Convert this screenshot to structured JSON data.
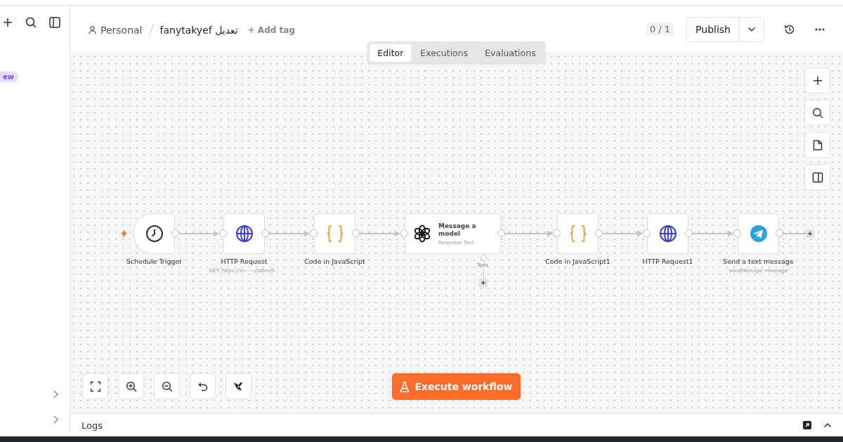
{
  "sidebar": {
    "badge": "ew"
  },
  "header": {
    "project": "Personal",
    "workflow": "fanytakyef تعديل",
    "add_tag": "+ Add tag",
    "counter": "0 / 1",
    "publish": "Publish"
  },
  "tabs": [
    {
      "label": "Editor",
      "selected": true
    },
    {
      "label": "Executions",
      "selected": false
    },
    {
      "label": "Evaluations",
      "selected": false
    }
  ],
  "nodes": [
    {
      "kind": "trigger",
      "label": "Schedule Trigger"
    },
    {
      "kind": "http",
      "label": "HTTP Request",
      "subtitle": "GET: https://xn-----ctdbnc9..."
    },
    {
      "kind": "code",
      "label": "Code in JavaScript"
    },
    {
      "kind": "ai",
      "label": "Message a model",
      "subtitle": "Response Text",
      "sub_port": "Tools"
    },
    {
      "kind": "code",
      "label": "Code in JavaScript1"
    },
    {
      "kind": "http",
      "label": "HTTP Request1"
    },
    {
      "kind": "telegram",
      "label": "Send a text message",
      "subtitle": "sendMessage: message"
    }
  ],
  "execute": "Execute workflow",
  "logs": {
    "title": "Logs"
  }
}
